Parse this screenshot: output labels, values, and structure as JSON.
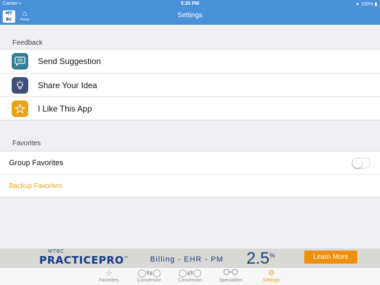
{
  "status_bar": {
    "carrier": "Carrier",
    "time": "5:20 PM",
    "battery": "100%"
  },
  "nav": {
    "title": "Settings",
    "logo_text": "MTBC",
    "home_label": "Home"
  },
  "feedback": {
    "header": "Feedback",
    "items": [
      {
        "label": "Send Suggestion",
        "icon": "speech-bubble-icon",
        "color": "#2f7f96"
      },
      {
        "label": "Share Your Idea",
        "icon": "lightbulb-icon",
        "color": "#3e4f7a"
      },
      {
        "label": "I Like This App",
        "icon": "star-icon",
        "color": "#e8a316"
      }
    ]
  },
  "favorites": {
    "header": "Favorites",
    "group_favorites_label": "Group Favorites",
    "group_favorites_enabled": false,
    "backup_label": "Backup Favorites"
  },
  "banner": {
    "company": "MTBC",
    "brand": "PRACTICEPRO",
    "trademark": "™",
    "services": "Billing - EHR - PM",
    "rate": "2.5",
    "rate_unit": "%",
    "cta": "Learn More"
  },
  "tabs": [
    {
      "label": "Favorites",
      "icon": "star-outline-icon",
      "active": false
    },
    {
      "label": "Conversion",
      "icon": "conversion-icon",
      "active": false
    },
    {
      "label": "Conversion",
      "icon": "conversion-alt-icon",
      "active": false
    },
    {
      "label": "Specialties",
      "icon": "glasses-icon",
      "active": false
    },
    {
      "label": "Settings",
      "icon": "gear-icon",
      "active": true
    }
  ],
  "colors": {
    "nav_bar": "#4a90d9",
    "accent": "#e8a316",
    "background": "#efeff4",
    "cta": "#ef8f10"
  }
}
